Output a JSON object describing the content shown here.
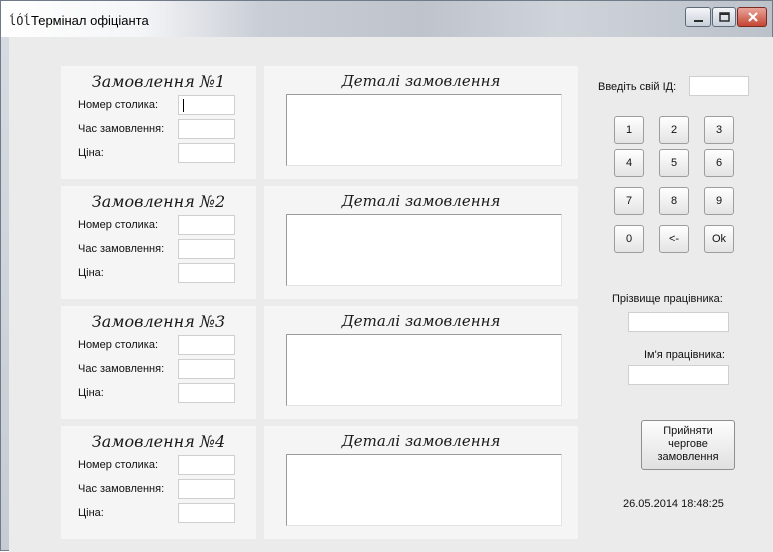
{
  "window": {
    "title": "Термінал офіціанта",
    "app_icon": "waiter-icon"
  },
  "orders": [
    {
      "title": "Замовлення №1",
      "table_label": "Номер столика:",
      "time_label": "Час замовлення:",
      "price_label": "Ціна:",
      "table_value": "",
      "time_value": "",
      "price_value": "",
      "details_title": "Деталі замовлення",
      "details_value": ""
    },
    {
      "title": "Замовлення №2",
      "table_label": "Номер столика:",
      "time_label": "Час замовлення:",
      "price_label": "Ціна:",
      "table_value": "",
      "time_value": "",
      "price_value": "",
      "details_title": "Деталі замовлення",
      "details_value": ""
    },
    {
      "title": "Замовлення №3",
      "table_label": "Номер столика:",
      "time_label": "Час замовлення:",
      "price_label": "Ціна:",
      "table_value": "",
      "time_value": "",
      "price_value": "",
      "details_title": "Деталі замовлення",
      "details_value": ""
    },
    {
      "title": "Замовлення №4",
      "table_label": "Номер столика:",
      "time_label": "Час замовлення:",
      "price_label": "Ціна:",
      "table_value": "",
      "time_value": "",
      "price_value": "",
      "details_title": "Деталі замовлення",
      "details_value": ""
    }
  ],
  "login": {
    "id_label": "Введіть свій ІД:",
    "id_value": ""
  },
  "keypad": {
    "keys": [
      "1",
      "2",
      "3",
      "4",
      "5",
      "6",
      "7",
      "8",
      "9",
      "0",
      "<-",
      "Ok"
    ]
  },
  "employee": {
    "surname_label": "Прізвище працівника:",
    "surname_value": "",
    "name_label": "Ім'я працівника:",
    "name_value": ""
  },
  "accept_button": {
    "line1": "Прийняти",
    "line2": "чергове",
    "line3": "замовлення"
  },
  "clock": "26.05.2014 18:48:25",
  "colors": {
    "close_button": "#c64533",
    "panel": "#f5f5f5",
    "background": "#ebebeb"
  }
}
